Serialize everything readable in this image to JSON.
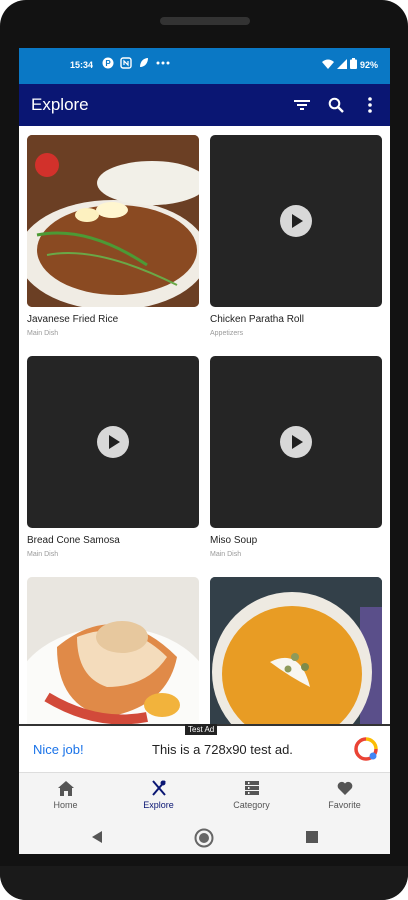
{
  "status_bar": {
    "time": "15:34",
    "icons": [
      "p-badge-icon",
      "nfc-icon",
      "leaf-icon",
      "more-dots-icon"
    ],
    "battery": "92%"
  },
  "app_bar": {
    "title": "Explore",
    "actions": [
      "filter-icon",
      "search-icon",
      "more-vert-icon"
    ]
  },
  "recipes": [
    {
      "title": "Javanese Fried Rice",
      "category": "Main Dish",
      "media": "image"
    },
    {
      "title": "Chicken Paratha Roll",
      "category": "Appetizers",
      "media": "video"
    },
    {
      "title": "Bread Cone Samosa",
      "category": "Main Dish",
      "media": "video"
    },
    {
      "title": "Miso Soup",
      "category": "Main Dish",
      "media": "video"
    },
    {
      "title": "",
      "category": "",
      "media": "image"
    },
    {
      "title": "",
      "category": "",
      "media": "image"
    }
  ],
  "ad": {
    "label": "Test Ad",
    "nice": "Nice job!",
    "text": "This is a 728x90 test ad."
  },
  "bottom_nav": {
    "items": [
      {
        "label": "Home",
        "icon": "home-icon"
      },
      {
        "label": "Explore",
        "icon": "utensils-icon",
        "selected": true
      },
      {
        "label": "Category",
        "icon": "category-icon"
      },
      {
        "label": "Favorite",
        "icon": "heart-icon"
      }
    ]
  },
  "colors": {
    "status_bar": "#0a78c5",
    "app_bar": "#0a1673",
    "ad_link": "#1a73e8"
  }
}
